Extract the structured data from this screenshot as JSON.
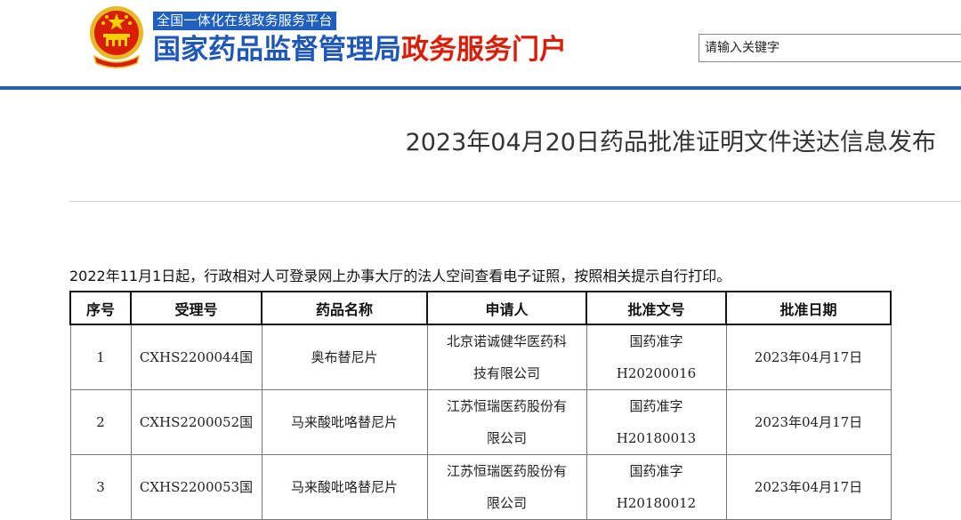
{
  "header": {
    "slogan": "全国一体化在线政务服务平台",
    "title_main": "国家药品监督管理局",
    "title_accent": "政务服务门户",
    "search_placeholder": "请输入关键字",
    "brand_colors": {
      "blue": "#1f57b8",
      "red": "#d81e06",
      "rule": "#1e5fbf"
    }
  },
  "page": {
    "title": "2023年04月20日药品批准证明文件送达信息发布",
    "notice": "2022年11月1日起，行政相对人可登录网上办事大厅的法人空间查看电子证照，按照相关提示自行打印。"
  },
  "table": {
    "headers": [
      "序号",
      "受理号",
      "药品名称",
      "申请人",
      "批准文号",
      "批准日期"
    ],
    "rows": [
      {
        "no": "1",
        "accept_no": "CXHS2200044国",
        "drug": "奥布替尼片",
        "applicant_l1": "北京诺诚健华医药科",
        "applicant_l2": "技有限公司",
        "approval_l1": "国药准字",
        "approval_l2": "H20200016",
        "date": "2023年04月17日"
      },
      {
        "no": "2",
        "accept_no": "CXHS2200052国",
        "drug": "马来酸吡咯替尼片",
        "applicant_l1": "江苏恒瑞医药股份有",
        "applicant_l2": "限公司",
        "approval_l1": "国药准字",
        "approval_l2": "H20180013",
        "date": "2023年04月17日"
      },
      {
        "no": "3",
        "accept_no": "CXHS2200053国",
        "drug": "马来酸吡咯替尼片",
        "applicant_l1": "江苏恒瑞医药股份有",
        "applicant_l2": "限公司",
        "approval_l1": "国药准字",
        "approval_l2": "H20180012",
        "date": "2023年04月17日"
      }
    ]
  }
}
